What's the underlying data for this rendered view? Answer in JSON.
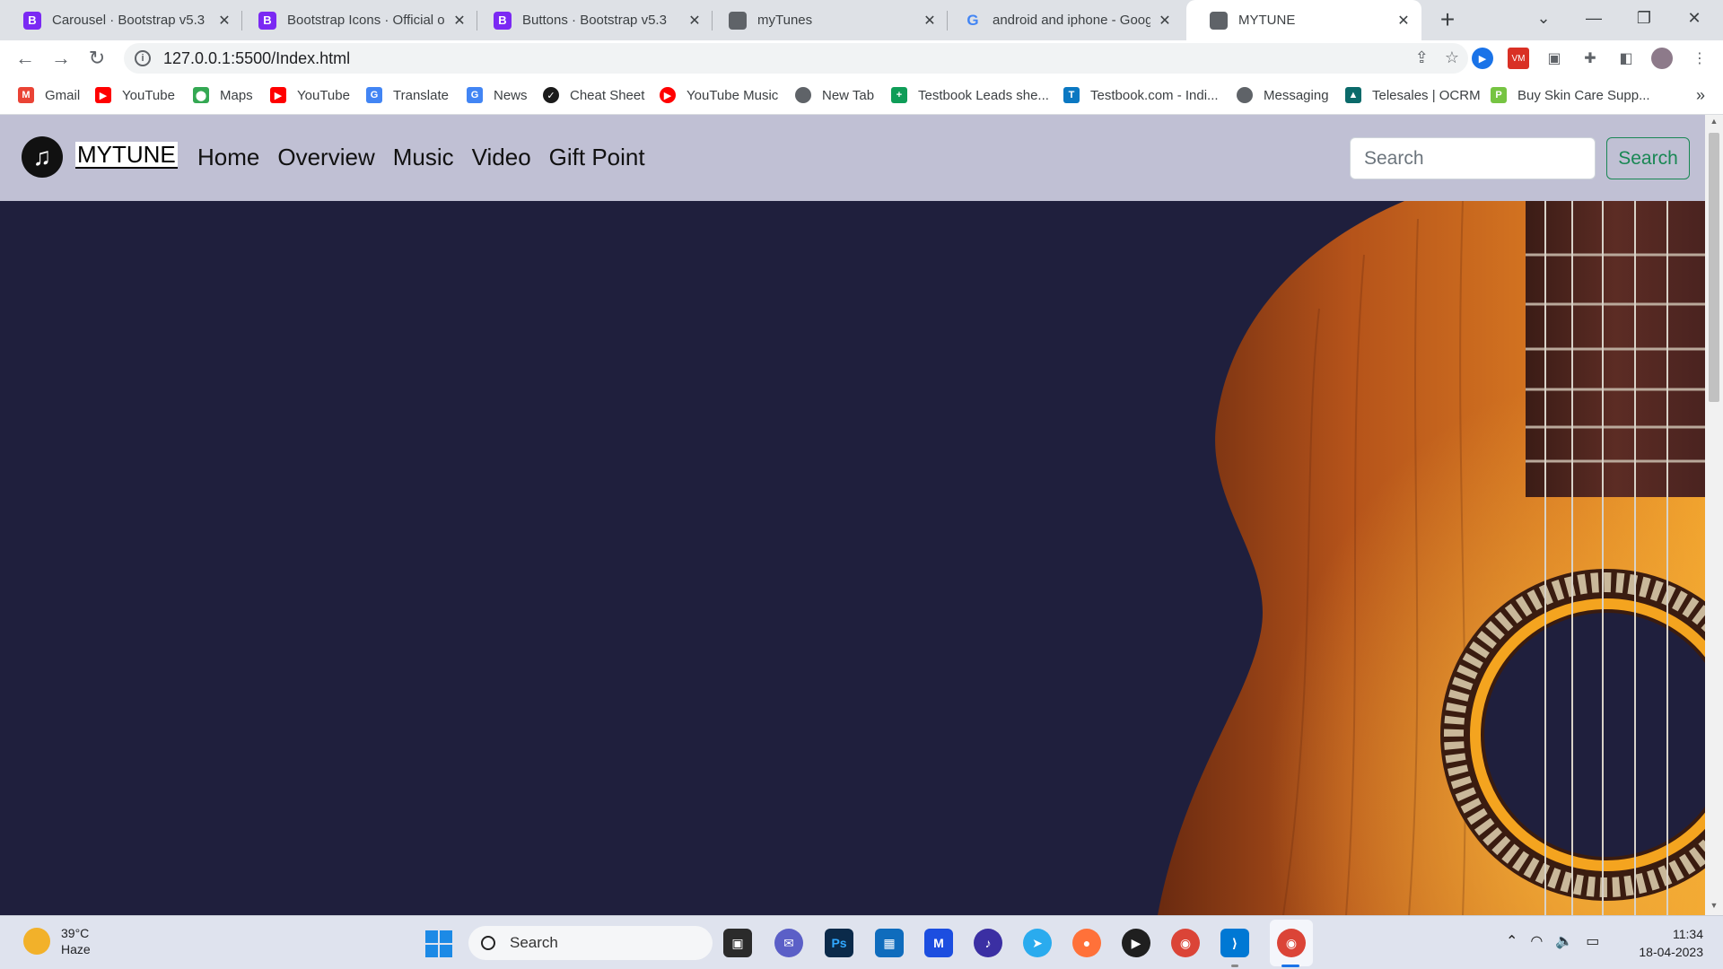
{
  "browser": {
    "tabs": [
      {
        "title": "Carousel · Bootstrap v5.3",
        "favicon": "bootstrap-icon",
        "active": false
      },
      {
        "title": "Bootstrap Icons · Official op",
        "favicon": "bootstrap-icon",
        "active": false
      },
      {
        "title": "Buttons · Bootstrap v5.3",
        "favicon": "bootstrap-icon",
        "active": false
      },
      {
        "title": "myTunes",
        "favicon": "globe-icon",
        "active": false
      },
      {
        "title": "android and iphone - Goog",
        "favicon": "google-icon",
        "active": false
      },
      {
        "title": "MYTUNE",
        "favicon": "globe-icon",
        "active": true
      }
    ],
    "address": {
      "url": "127.0.0.1:5500/Index.html"
    },
    "bookmarks": [
      {
        "label": "Gmail",
        "icon": "gmail-icon",
        "color": "#ea4335"
      },
      {
        "label": "YouTube",
        "icon": "youtube-icon",
        "color": "#ff0000"
      },
      {
        "label": "Maps",
        "icon": "maps-icon",
        "color": "#34a853"
      },
      {
        "label": "YouTube",
        "icon": "youtube-icon",
        "color": "#ff0000"
      },
      {
        "label": "Translate",
        "icon": "translate-icon",
        "color": "#4285f4"
      },
      {
        "label": "News",
        "icon": "news-icon",
        "color": "#4285f4"
      },
      {
        "label": "Cheat Sheet",
        "icon": "cheat-sheet-icon",
        "color": "#1a1a1a"
      },
      {
        "label": "YouTube Music",
        "icon": "youtube-music-icon",
        "color": "#ff0000"
      },
      {
        "label": "New Tab",
        "icon": "globe-icon",
        "color": "#5f6368"
      },
      {
        "label": "Testbook Leads she...",
        "icon": "sheets-icon",
        "color": "#0f9d58"
      },
      {
        "label": "Testbook.com - Indi...",
        "icon": "testbook-icon",
        "color": "#0b78c2"
      },
      {
        "label": "Messaging",
        "icon": "globe-icon",
        "color": "#5f6368"
      },
      {
        "label": "Telesales | OCRM",
        "icon": "ocrm-icon",
        "color": "#0b6a6a"
      },
      {
        "label": "Buy Skin Care Supp...",
        "icon": "skincare-icon",
        "color": "#76c442"
      }
    ]
  },
  "site": {
    "brand": "MYTUNE",
    "nav": [
      "Home",
      "Overview",
      "Music",
      "Video",
      "Gift Point"
    ],
    "search": {
      "placeholder": "Search",
      "button": "Search"
    },
    "colors": {
      "navbar": "#c0c0d4",
      "hero_bg": "#1f1f3d",
      "search_button": "#198754"
    }
  },
  "taskbar": {
    "weather": {
      "temp": "39°C",
      "condition": "Haze"
    },
    "search_label": "Search",
    "clock": {
      "time": "11:34",
      "date": "18-04-2023"
    }
  }
}
